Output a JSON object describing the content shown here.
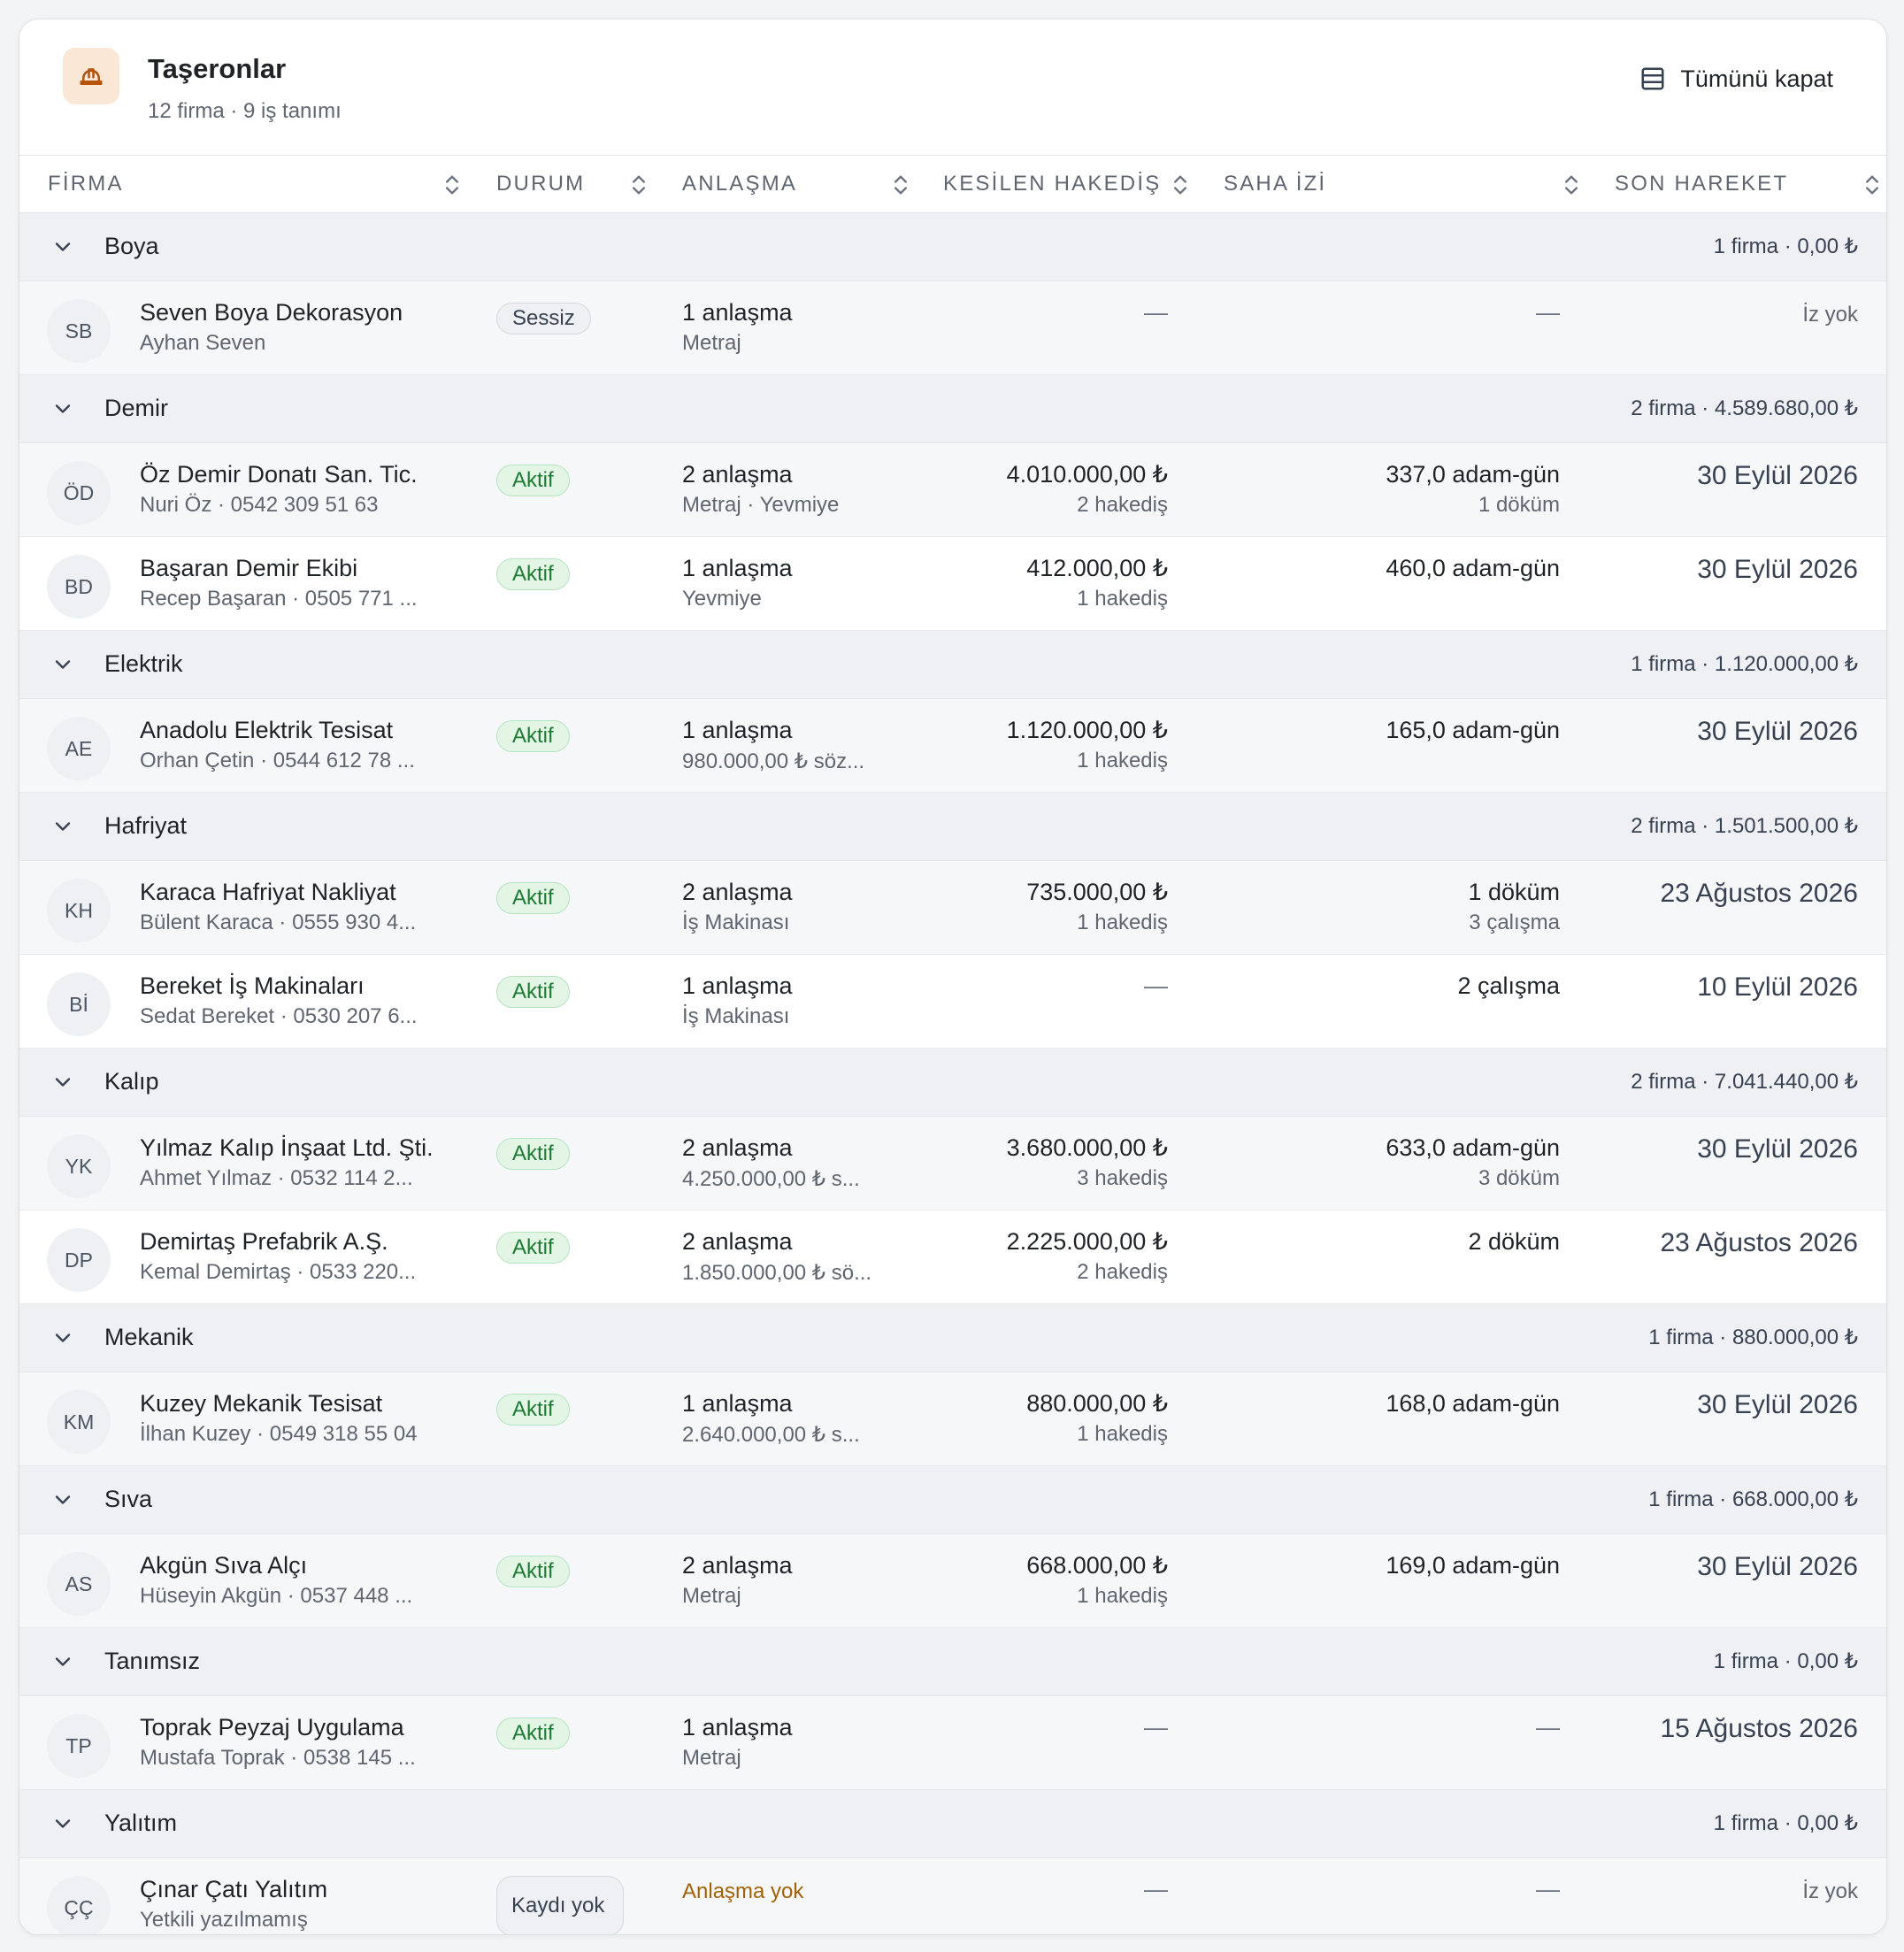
{
  "header": {
    "title": "Taşeronlar",
    "subtitle": "12 firma · 9 iş tanımı",
    "collapse_label": "Tümünü kapat"
  },
  "columns": [
    "FİRMA",
    "DURUM",
    "ANLAŞMA",
    "KESİLEN HAKEDİŞ",
    "SAHA İZİ",
    "SON HAREKET"
  ],
  "colors": {
    "accent_bg": "#fbe7d6",
    "accent": "#b45309",
    "active_badge_bg": "#e3f6e6",
    "active_badge_text": "#1e7a33",
    "warning_text": "#a16207"
  },
  "groups": [
    {
      "name": "Boya",
      "summary": "1 firma · 0,00 ₺",
      "rows": [
        {
          "initials": "SB",
          "name": "Seven Boya Dekorasyon",
          "contact": "Ayhan Seven",
          "status": "Sessiz",
          "deals": "1 anlaşma",
          "deal_type": "Metraj",
          "amount": "—",
          "amount_sub": "",
          "site": "—",
          "site_sub": "",
          "last": "İz yok"
        }
      ]
    },
    {
      "name": "Demir",
      "summary": "2 firma · 4.589.680,00 ₺",
      "rows": [
        {
          "initials": "ÖD",
          "name": "Öz Demir Donatı San. Tic.",
          "contact": "Nuri Öz · 0542 309 51 63",
          "status": "Aktif",
          "deals": "2 anlaşma",
          "deal_type": "Metraj · Yevmiye",
          "amount": "4.010.000,00 ₺",
          "amount_sub": "2 hakediş",
          "site": "337,0 adam-gün",
          "site_sub": "1 döküm",
          "last": "30 Eylül 2026"
        },
        {
          "initials": "BD",
          "name": "Başaran Demir Ekibi",
          "contact": "Recep Başaran · 0505 771 ...",
          "status": "Aktif",
          "deals": "1 anlaşma",
          "deal_type": "Yevmiye",
          "amount": "412.000,00 ₺",
          "amount_sub": "1 hakediş",
          "site": "460,0 adam-gün",
          "site_sub": "",
          "last": "30 Eylül 2026"
        }
      ]
    },
    {
      "name": "Elektrik",
      "summary": "1 firma · 1.120.000,00 ₺",
      "rows": [
        {
          "initials": "AE",
          "name": "Anadolu Elektrik Tesisat",
          "contact": "Orhan Çetin · 0544 612 78 ...",
          "status": "Aktif",
          "deals": "1 anlaşma",
          "deal_type": "980.000,00 ₺ söz...",
          "amount": "1.120.000,00 ₺",
          "amount_sub": "1 hakediş",
          "site": "165,0 adam-gün",
          "site_sub": "",
          "last": "30 Eylül 2026"
        }
      ]
    },
    {
      "name": "Hafriyat",
      "summary": "2 firma · 1.501.500,00 ₺",
      "rows": [
        {
          "initials": "KH",
          "name": "Karaca Hafriyat Nakliyat",
          "contact": "Bülent Karaca · 0555 930 4...",
          "status": "Aktif",
          "deals": "2 anlaşma",
          "deal_type": "İş Makinası",
          "amount": "735.000,00 ₺",
          "amount_sub": "1 hakediş",
          "site": "1 döküm",
          "site_sub": "3 çalışma",
          "last": "23 Ağustos 2026"
        },
        {
          "initials": "Bİ",
          "name": "Bereket İş Makinaları",
          "contact": "Sedat Bereket · 0530 207 6...",
          "status": "Aktif",
          "deals": "1 anlaşma",
          "deal_type": "İş Makinası",
          "amount": "—",
          "amount_sub": "",
          "site": "2 çalışma",
          "site_sub": "",
          "last": "10 Eylül 2026"
        }
      ]
    },
    {
      "name": "Kalıp",
      "summary": "2 firma · 7.041.440,00 ₺",
      "rows": [
        {
          "initials": "YK",
          "name": "Yılmaz Kalıp İnşaat Ltd. Şti.",
          "contact": "Ahmet Yılmaz · 0532 114 2...",
          "status": "Aktif",
          "deals": "2 anlaşma",
          "deal_type": "4.250.000,00 ₺ s...",
          "amount": "3.680.000,00 ₺",
          "amount_sub": "3 hakediş",
          "site": "633,0 adam-gün",
          "site_sub": "3 döküm",
          "last": "30 Eylül 2026"
        },
        {
          "initials": "DP",
          "name": "Demirtaş Prefabrik A.Ş.",
          "contact": "Kemal Demirtaş · 0533 220...",
          "status": "Aktif",
          "deals": "2 anlaşma",
          "deal_type": "1.850.000,00 ₺ sö...",
          "amount": "2.225.000,00 ₺",
          "amount_sub": "2 hakediş",
          "site": "2 döküm",
          "site_sub": "",
          "last": "23 Ağustos 2026"
        }
      ]
    },
    {
      "name": "Mekanik",
      "summary": "1 firma · 880.000,00 ₺",
      "rows": [
        {
          "initials": "KM",
          "name": "Kuzey Mekanik Tesisat",
          "contact": "İlhan Kuzey · 0549 318 55 04",
          "status": "Aktif",
          "deals": "1 anlaşma",
          "deal_type": "2.640.000,00 ₺ s...",
          "amount": "880.000,00 ₺",
          "amount_sub": "1 hakediş",
          "site": "168,0 adam-gün",
          "site_sub": "",
          "last": "30 Eylül 2026"
        }
      ]
    },
    {
      "name": "Sıva",
      "summary": "1 firma · 668.000,00 ₺",
      "rows": [
        {
          "initials": "AS",
          "name": "Akgün Sıva Alçı",
          "contact": "Hüseyin Akgün · 0537 448 ...",
          "status": "Aktif",
          "deals": "2 anlaşma",
          "deal_type": "Metraj",
          "amount": "668.000,00 ₺",
          "amount_sub": "1 hakediş",
          "site": "169,0 adam-gün",
          "site_sub": "",
          "last": "30 Eylül 2026"
        }
      ]
    },
    {
      "name": "Tanımsız",
      "summary": "1 firma · 0,00 ₺",
      "rows": [
        {
          "initials": "TP",
          "name": "Toprak Peyzaj Uygulama",
          "contact": "Mustafa Toprak · 0538 145 ...",
          "status": "Aktif",
          "deals": "1 anlaşma",
          "deal_type": "Metraj",
          "amount": "—",
          "amount_sub": "",
          "site": "—",
          "site_sub": "",
          "last": "15 Ağustos 2026"
        }
      ]
    },
    {
      "name": "Yalıtım",
      "summary": "1 firma · 0,00 ₺",
      "rows": [
        {
          "initials": "ÇÇ",
          "name": "Çınar Çatı Yalıtım",
          "contact": "Yetkili yazılmamış",
          "status": "Kaydı yok",
          "deals": "Anlaşma yok",
          "deal_type": "",
          "amount": "—",
          "amount_sub": "",
          "site": "—",
          "site_sub": "",
          "last": "İz yok"
        }
      ]
    }
  ]
}
